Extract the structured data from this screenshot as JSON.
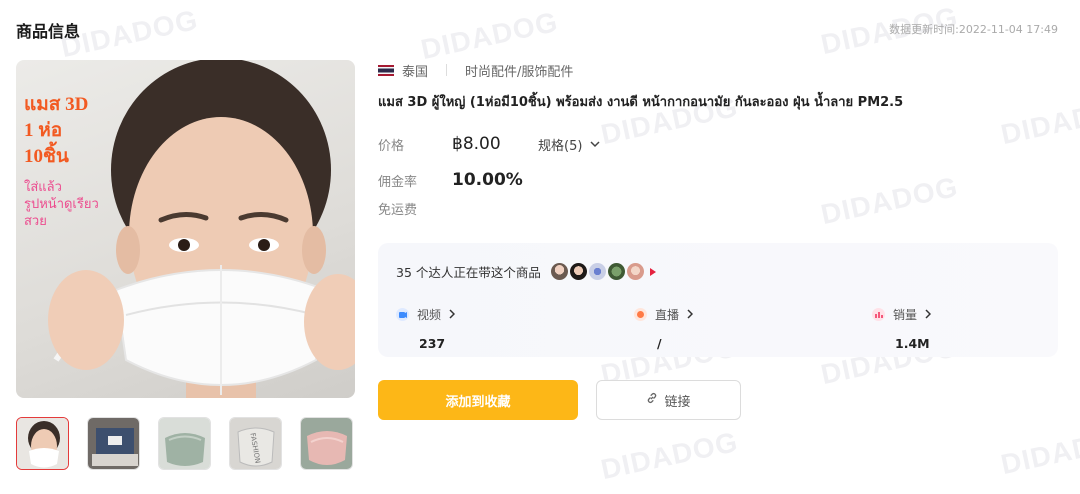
{
  "header": {
    "title": "商品信息",
    "update_time": "数据更新时间:2022-11-04 17:49"
  },
  "watermark": "DIDADOG",
  "image": {
    "overlay_lines": [
      "แมส 3D",
      "1 ห่อ",
      "10ชิ้น"
    ],
    "overlay_sub": [
      "ใส่แล้ว",
      "รูปหน้าดูเรียว",
      "สวย"
    ]
  },
  "product": {
    "country": "泰国",
    "category": "时尚配件/服饰配件",
    "title": "แมส 3D ผู้ใหญ่ (1ห่อมี10ชิ้น) พร้อมส่ง งานดี หน้ากากอนามัย กันละออง ฝุ่น น้ำลาย PM2.5",
    "price_label": "价格",
    "price": "฿8.00",
    "spec": "规格(5)",
    "commission_label": "佣金率",
    "commission": "10.00%",
    "shipping_label": "免运费"
  },
  "stats": {
    "creators_text": "35 个达人正在带这个商品",
    "items": [
      {
        "label": "视频",
        "value": "237"
      },
      {
        "label": "直播",
        "value": "/"
      },
      {
        "label": "销量",
        "value": "1.4M"
      }
    ]
  },
  "actions": {
    "favorite": "添加到收藏",
    "link": "链接"
  },
  "colors": {
    "accent": "#fdb717",
    "video": "#3d8bfd",
    "live": "#ff7a45",
    "sales": "#f5577a"
  }
}
